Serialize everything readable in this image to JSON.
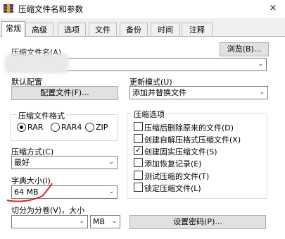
{
  "window": {
    "title": "压缩文件名和参数",
    "close_glyph": "×"
  },
  "tabs": [
    "常规",
    "高级",
    "选项",
    "文件",
    "备份",
    "时间",
    "注释"
  ],
  "archive_name": {
    "label": "压缩文件名(A)",
    "browse_button": "浏览(B)...",
    "value": ""
  },
  "profile": {
    "label": "默认配置",
    "button": "配置文件(F)..."
  },
  "update_mode": {
    "label": "更新模式(U)",
    "value": "添加并替换文件"
  },
  "archive_format": {
    "label": "压缩文件格式",
    "options": [
      "RAR",
      "RAR4",
      "ZIP"
    ],
    "selected": "RAR"
  },
  "compression_method": {
    "label": "压缩方式(C)",
    "value": "最好"
  },
  "dictionary": {
    "label": "字典大小(I)",
    "value": "64 MB"
  },
  "split": {
    "label": "切分为分卷(V)，大小",
    "value": "",
    "unit": "MB"
  },
  "options_group": {
    "label": "压缩选项",
    "items": [
      {
        "label": "压缩后删除原来的文件(D)",
        "checked": false
      },
      {
        "label": "创建自解压格式压缩文件(X)",
        "checked": false
      },
      {
        "label": "创建固实压缩文件(S)",
        "checked": true
      },
      {
        "label": "添加恢复记录(E)",
        "checked": false
      },
      {
        "label": "测试压缩的文件(T)",
        "checked": false
      },
      {
        "label": "锁定压缩文件(L)",
        "checked": false
      }
    ]
  },
  "set_password_button": "设置密码(P)...",
  "annotation_color": "#e0201b"
}
